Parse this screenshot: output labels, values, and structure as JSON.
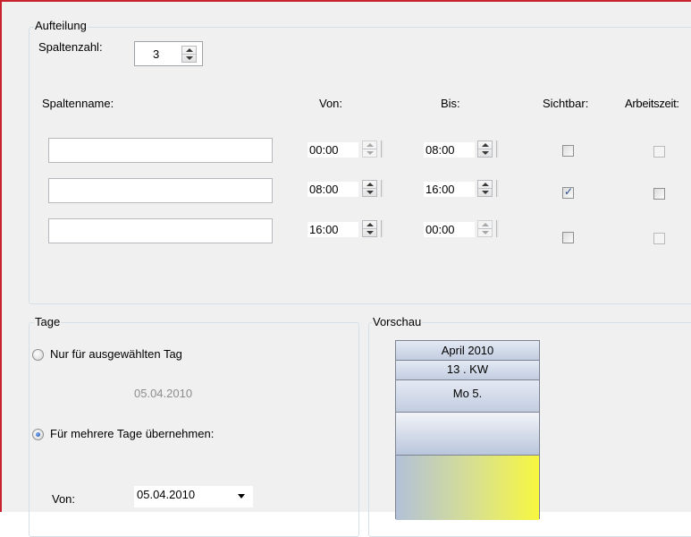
{
  "aufteilung": {
    "legend": "Aufteilung",
    "spaltenzahl_label": "Spaltenzahl:",
    "spaltenzahl_value": "3",
    "headers": {
      "name": "Spaltenname:",
      "von": "Von:",
      "bis": "Bis:",
      "sichtbar": "Sichtbar:",
      "arbeitszeit": "Arbeitszeit:"
    },
    "rows": [
      {
        "name": "",
        "von": "00:00",
        "bis": "08:00",
        "sichtbar": false,
        "arbeitszeit": false
      },
      {
        "name": "",
        "von": "08:00",
        "bis": "16:00",
        "sichtbar": true,
        "arbeitszeit": false
      },
      {
        "name": "",
        "von": "16:00",
        "bis": "00:00",
        "sichtbar": false,
        "arbeitszeit": false
      }
    ]
  },
  "tage": {
    "legend": "Tage",
    "option_single": "Nur für ausgewählten Tag",
    "single_date": "05.04.2010",
    "option_multiple": "Für mehrere Tage übernehmen:",
    "selected_option": "multiple",
    "von_label": "Von:",
    "von_value": "05.04.2010"
  },
  "vorschau": {
    "legend": "Vorschau",
    "month": "April 2010",
    "week": "13 . KW",
    "day": "Mo 5."
  },
  "colors": {
    "window_border": "#c8222d",
    "group_border": "#d5dfe5",
    "preview_yellow": "#f7f73f",
    "preview_blue": "#b2c1d9"
  }
}
